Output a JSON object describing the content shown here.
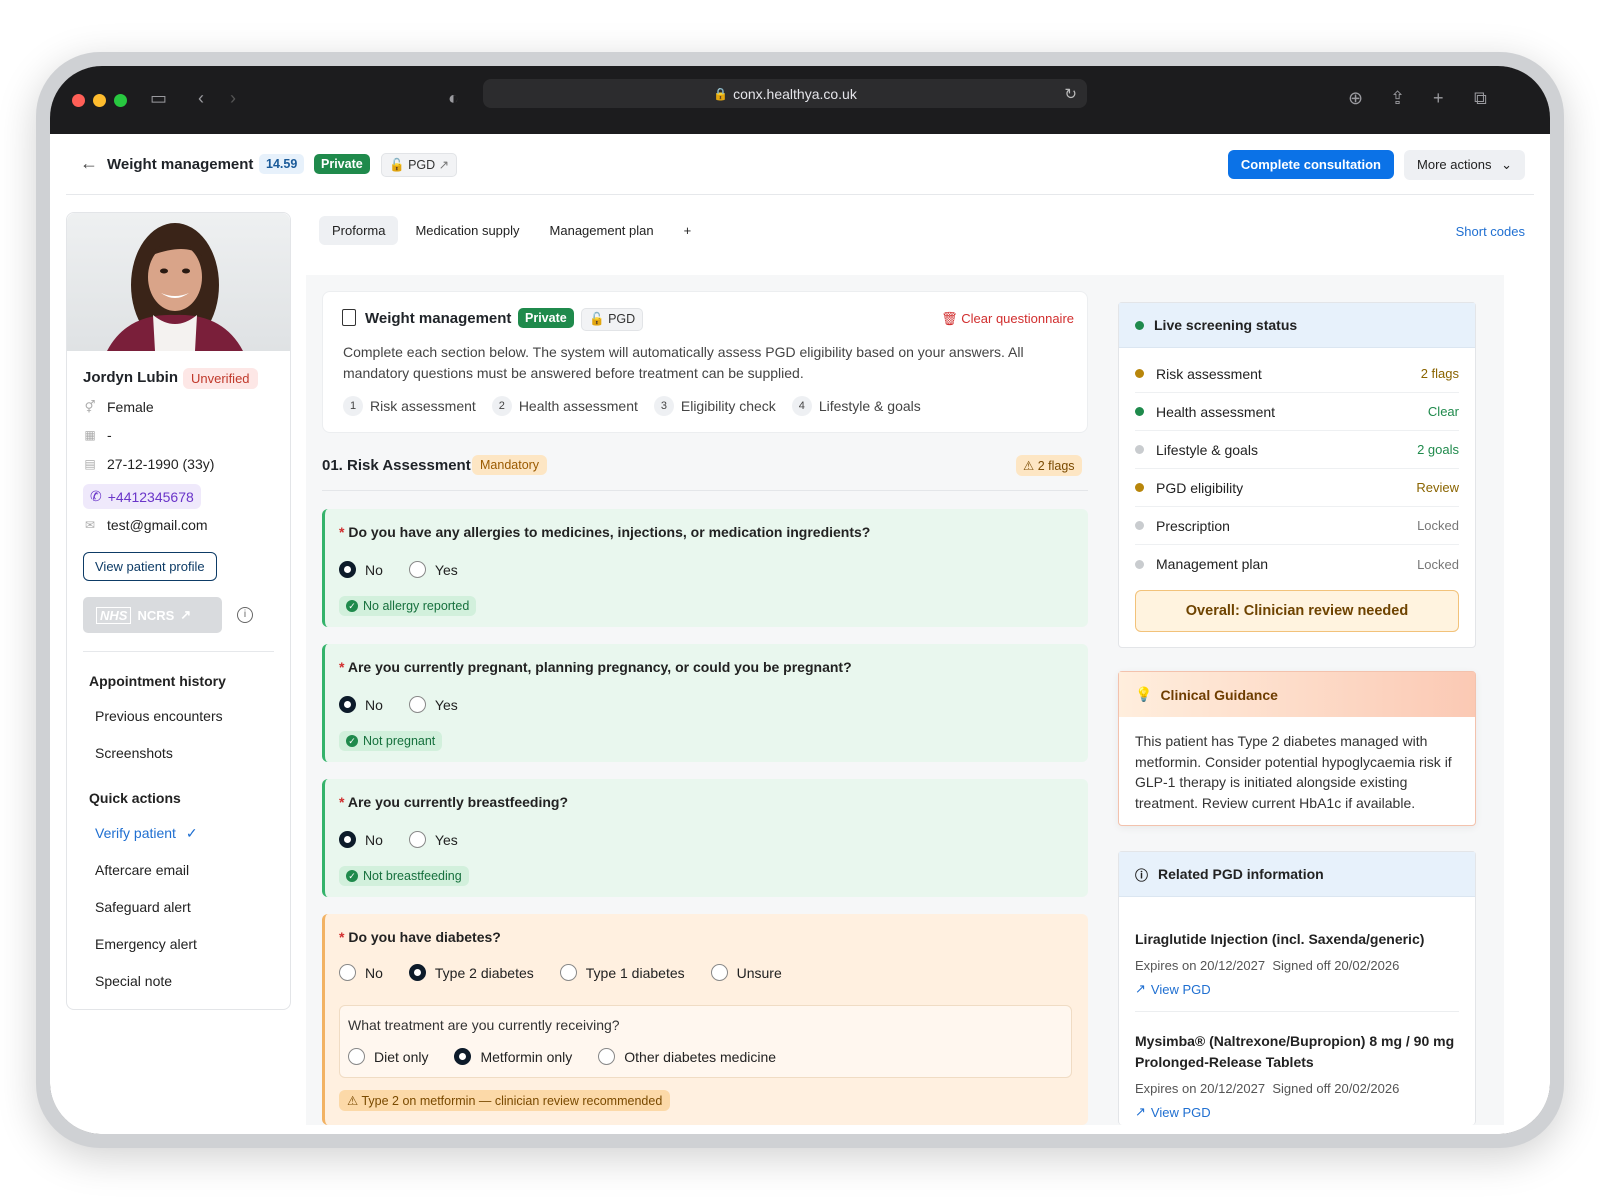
{
  "browser": {
    "url": "conx.healthya.co.uk"
  },
  "header": {
    "title": "Weight management",
    "score": "14.59",
    "badge_private": "Private",
    "badge_pgd": "PGD",
    "complete_button": "Complete consultation",
    "more_actions": "More actions"
  },
  "patient": {
    "name": "Jordyn Lubin",
    "status": "Unverified",
    "gender": "Female",
    "nhs_number": "-",
    "dob": "27-12-1990 (33y)",
    "phone": "+4412345678",
    "email": "test@gmail.com",
    "view_profile": "View patient profile",
    "ncrs_logo": "NHS",
    "ncrs_label": "NCRS"
  },
  "sidebar": {
    "appointment_history_title": "Appointment history",
    "appointment_items": [
      "Previous encounters",
      "Screenshots"
    ],
    "quick_actions_title": "Quick actions",
    "verify_patient": "Verify patient",
    "quick_items": [
      "Aftercare email",
      "Safeguard alert",
      "Emergency alert",
      "Special note"
    ]
  },
  "tabs": [
    "Proforma",
    "Medication supply",
    "Management plan",
    "+"
  ],
  "short_codes": "Short codes",
  "questionnaire": {
    "title": "Weight management",
    "badge_private": "Private",
    "badge_pgd": "PGD",
    "clear": "Clear questionnaire",
    "description": "Complete each section below. The system will automatically assess PGD eligibility based on your answers. All mandatory questions must be answered before treatment can be supplied.",
    "steps": [
      {
        "num": "1",
        "label": "Risk assessment"
      },
      {
        "num": "2",
        "label": "Health assessment"
      },
      {
        "num": "3",
        "label": "Eligibility check"
      },
      {
        "num": "4",
        "label": "Lifestyle & goals"
      }
    ]
  },
  "section": {
    "title": "01. Risk Assessment",
    "mandatory": "Mandatory",
    "flags": "2 flags"
  },
  "questions": [
    {
      "text": "Do you have any allergies to medicines, injections, or medication ingredients?",
      "options": [
        "No",
        "Yes"
      ],
      "selected": "No",
      "result": "No allergy reported"
    },
    {
      "text": "Are you currently pregnant, planning pregnancy, or could you be pregnant?",
      "options": [
        "No",
        "Yes"
      ],
      "selected": "No",
      "result": "Not pregnant"
    },
    {
      "text": "Are you currently breastfeeding?",
      "options": [
        "No",
        "Yes"
      ],
      "selected": "No",
      "result": "Not breastfeeding"
    },
    {
      "text": "Do you have diabetes?",
      "options": [
        "No",
        "Type 2 diabetes",
        "Type 1 diabetes",
        "Unsure"
      ],
      "selected": "Type 2 diabetes",
      "sub_question": "What treatment are you currently receiving?",
      "sub_options": [
        "Diet only",
        "Metformin only",
        "Other diabetes medicine"
      ],
      "sub_selected": "Metformin only",
      "warning": "Type 2 on metformin — clinician review recommended"
    }
  ],
  "screening": {
    "title": "Live screening status",
    "rows": [
      {
        "label": "Risk assessment",
        "value": "2 flags",
        "color": "#b8860b"
      },
      {
        "label": "Health assessment",
        "value": "Clear",
        "color": "#1f8a4c"
      },
      {
        "label": "Lifestyle & goals",
        "value": "2 goals",
        "color": "#1f8a4c"
      },
      {
        "label": "PGD eligibility",
        "value": "Review",
        "color": "#b8860b"
      },
      {
        "label": "Prescription",
        "value": "Locked",
        "color": "#777777"
      },
      {
        "label": "Management plan",
        "value": "Locked",
        "color": "#777777"
      }
    ],
    "overall": "Overall: Clinician review needed"
  },
  "guidance": {
    "title": "Clinical Guidance",
    "text": "This patient has Type 2 diabetes managed with metformin. Consider potential hypoglycaemia risk if GLP-1 therapy is initiated alongside existing treatment. Review current HbA1c if available."
  },
  "related_pgd": {
    "title": "Related PGD information",
    "items": [
      {
        "name": "Liraglutide Injection (incl. Saxenda/generic)",
        "expires": "Expires on 20/12/2027",
        "signed": "Signed off 20/02/2026",
        "link": "View PGD"
      },
      {
        "name": "Mysimba® (Naltrexone/Bupropion) 8 mg / 90 mg Prolonged-Release Tablets",
        "expires": "Expires on 20/12/2027",
        "signed": "Signed off 20/02/2026",
        "link": "View PGD"
      }
    ]
  }
}
